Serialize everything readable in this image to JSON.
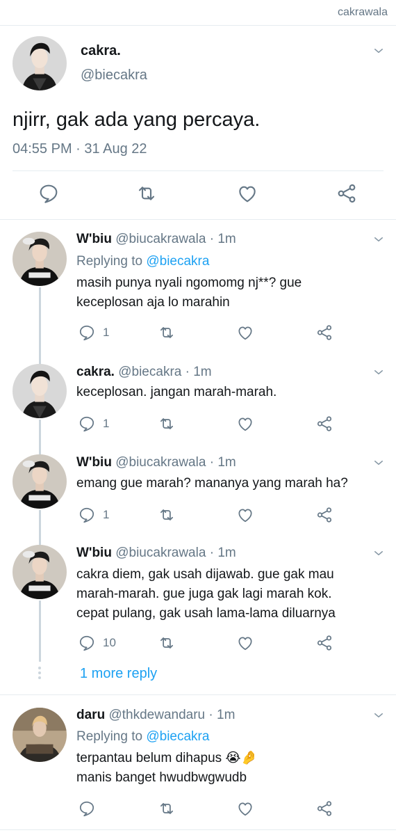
{
  "header": {
    "handle": "cakrawala"
  },
  "main_tweet": {
    "name": "cakra.",
    "handle": "@biecakra",
    "text": "njirr, gak ada yang percaya.",
    "time": "04:55 PM",
    "separator": "·",
    "date": "31 Aug 22"
  },
  "replies": [
    {
      "name": "W'biu",
      "handle": "@biucakrawala",
      "dot": "·",
      "time": "1m",
      "replying_prefix": "Replying to ",
      "replying_to": "@biecakra",
      "text": "masih punya nyali ngomomg nj**? gue\nkeceplosan aja lo marahin",
      "reply_count": "1"
    },
    {
      "name": "cakra.",
      "handle": "@biecakra",
      "dot": "·",
      "time": "1m",
      "text": "keceplosan. jangan marah-marah.",
      "reply_count": "1"
    },
    {
      "name": "W'biu",
      "handle": "@biucakrawala",
      "dot": "·",
      "time": "1m",
      "text": "emang gue marah? mananya yang marah ha?",
      "reply_count": "1"
    },
    {
      "name": "W'biu",
      "handle": "@biucakrawala",
      "dot": "·",
      "time": "1m",
      "text": "cakra diem, gak usah dijawab. gue gak mau\nmarah-marah. gue juga gak lagi marah kok.\ncepat pulang, gak usah lama-lama diluarnya",
      "reply_count": "10"
    },
    {
      "name": "daru",
      "handle": "@thkdewandaru",
      "dot": "·",
      "time": "1m",
      "replying_prefix": "Replying to ",
      "replying_to": "@biecakra",
      "text": "terpantau belum dihapus 😭🤌\nmanis banget hwudbwgwudb",
      "reply_count": ""
    }
  ],
  "more_replies": "1 more reply",
  "icons": {
    "reply": "reply-icon",
    "retweet": "retweet-icon",
    "like": "like-icon",
    "share": "share-icon",
    "menu": "chevron-down-icon"
  },
  "colors": {
    "accent": "#1da1f2",
    "secondary_text": "#657786",
    "divider": "#e6ecf0",
    "thread_line": "#ccd6dd"
  }
}
